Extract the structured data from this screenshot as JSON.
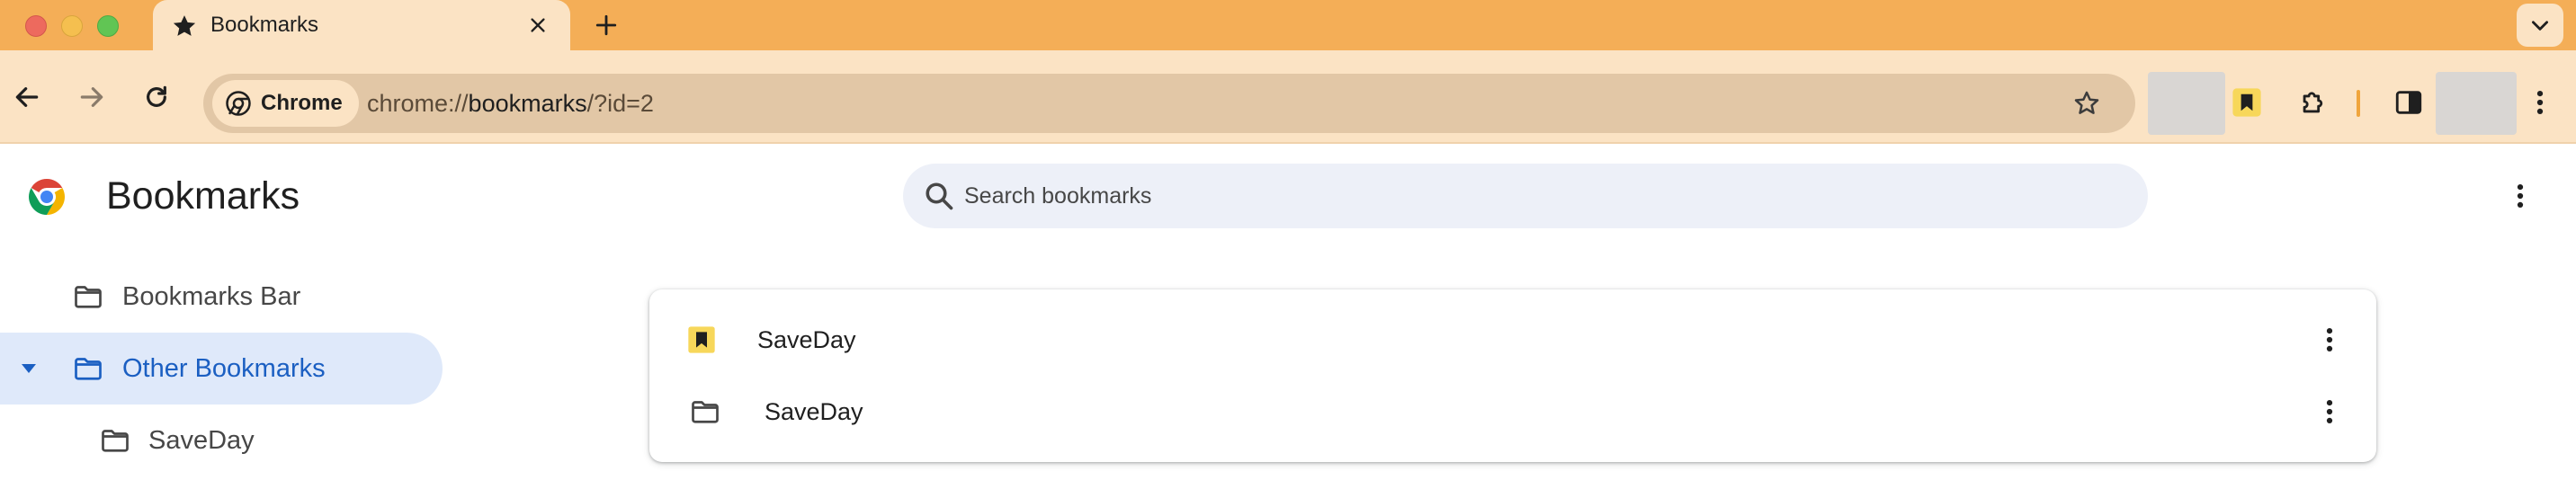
{
  "tab": {
    "title": "Bookmarks"
  },
  "toolbar": {
    "chip_label": "Chrome",
    "url_scheme": "chrome://",
    "url_domain": "bookmarks",
    "url_path": "/?id=2"
  },
  "page": {
    "title": "Bookmarks",
    "search_placeholder": "Search bookmarks"
  },
  "sidebar": {
    "items": [
      {
        "label": "Bookmarks Bar",
        "icon": "folder-icon"
      },
      {
        "label": "Other Bookmarks",
        "icon": "folder-icon",
        "active": true
      },
      {
        "label": "SaveDay",
        "icon": "folder-icon"
      }
    ]
  },
  "list": {
    "rows": [
      {
        "title": "SaveDay",
        "icon": "saveday-favicon-icon"
      },
      {
        "title": "SaveDay",
        "icon": "folder-icon"
      }
    ]
  },
  "colors": {
    "tabstrip": "#f4ae57",
    "toolbar": "#fbe3c4",
    "omnibox": "#e2c7a6",
    "active_item": "#dfe9fa",
    "active_text": "#1b5fc2",
    "search_bg": "#edf0f8",
    "saveday_brand": "#f7d75a"
  }
}
